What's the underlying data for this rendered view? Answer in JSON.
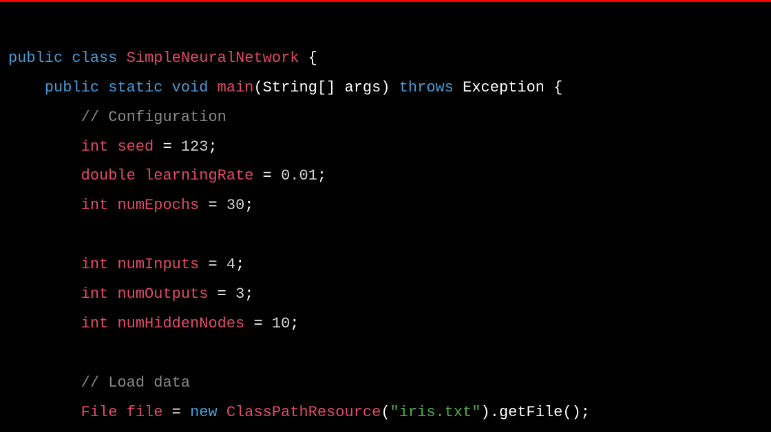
{
  "code": {
    "line1": {
      "kw1": "public",
      "kw2": "class",
      "className": "SimpleNeuralNetwork",
      "brace": " {"
    },
    "line2": {
      "indent": "    ",
      "kw1": "public",
      "kw2": "static",
      "kw3": "void",
      "fn": "main",
      "params": "(String[] args)",
      "throws": "throws",
      "exc": "Exception",
      "brace": " {"
    },
    "line3": {
      "indent": "        ",
      "comment": "// Configuration"
    },
    "line4": {
      "indent": "        ",
      "type": "int",
      "var": "seed",
      "eq": " = ",
      "val": "123",
      "semi": ";"
    },
    "line5": {
      "indent": "        ",
      "type": "double",
      "var": "learningRate",
      "eq": " = ",
      "val": "0.01",
      "semi": ";"
    },
    "line6": {
      "indent": "        ",
      "type": "int",
      "var": "numEpochs",
      "eq": " = ",
      "val": "30",
      "semi": ";"
    },
    "line7": {
      "indent": "        ",
      "type": "int",
      "var": "numInputs",
      "eq": " = ",
      "val": "4",
      "semi": ";"
    },
    "line8": {
      "indent": "        ",
      "type": "int",
      "var": "numOutputs",
      "eq": " = ",
      "val": "3",
      "semi": ";"
    },
    "line9": {
      "indent": "        ",
      "type": "int",
      "var": "numHiddenNodes",
      "eq": " = ",
      "val": "10",
      "semi": ";"
    },
    "line10": {
      "indent": "        ",
      "comment": "// Load data"
    },
    "line11": {
      "indent": "        ",
      "type": "File",
      "var": "file",
      "eq": " = ",
      "new": "new",
      "ctor": "ClassPathResource",
      "open": "(",
      "str": "\"iris.txt\"",
      "close": ")",
      "dot": ".",
      "method": "getFile",
      "call": "();"
    }
  }
}
